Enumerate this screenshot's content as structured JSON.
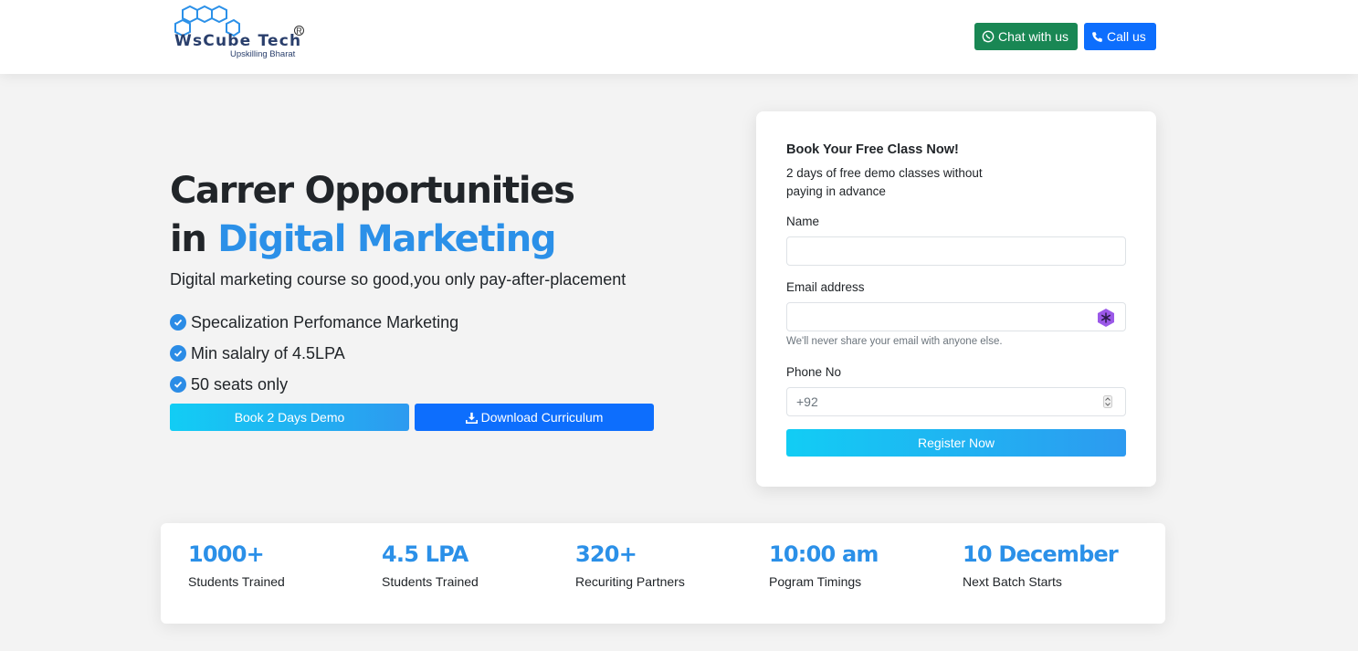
{
  "header": {
    "logo": {
      "brand": "WsCube",
      "brand_second": "Tech",
      "registered": "R",
      "tagline": "Upskilling Bharat"
    },
    "chat_label": "Chat with us",
    "call_label": "Call us",
    "colors": {
      "chat": "#198754",
      "call": "#0d6efd"
    }
  },
  "hero": {
    "title_line1": "Carrer Opportunities",
    "title_in": "in ",
    "title_accent": "Digital Marketing",
    "subtitle": "Digital marketing course so good,you only pay-after-placement",
    "features": [
      "Specalization Perfomance Marketing",
      "Min salalry of 4.5LPA",
      "50 seats only"
    ],
    "demo_button": "Book 2 Days Demo",
    "download_button": "Download Curriculum",
    "accent_color": "#2b90e8"
  },
  "form": {
    "title": "Book Your Free Class Now!",
    "description": "2 days of free demo classes without paying in advance",
    "name_label": "Name",
    "name_value": "",
    "email_label": "Email address",
    "email_value": "",
    "email_help": "We'll never share your email with anyone else.",
    "phone_label": "Phone No",
    "phone_value": "+92",
    "submit": "Register Now"
  },
  "stats": [
    {
      "value": "1000+",
      "label": "Students Trained"
    },
    {
      "value": "4.5 LPA",
      "label": "Students Trained"
    },
    {
      "value": "320+",
      "label": "Recuriting Partners"
    },
    {
      "value": "10:00 am",
      "label": "Pogram Timings"
    },
    {
      "value": "10 December",
      "label": "Next Batch Starts"
    }
  ],
  "icons": [
    "whatsapp-icon",
    "phone-icon",
    "check-circle-icon",
    "download-icon",
    "extension-icon",
    "spinner-icon"
  ]
}
